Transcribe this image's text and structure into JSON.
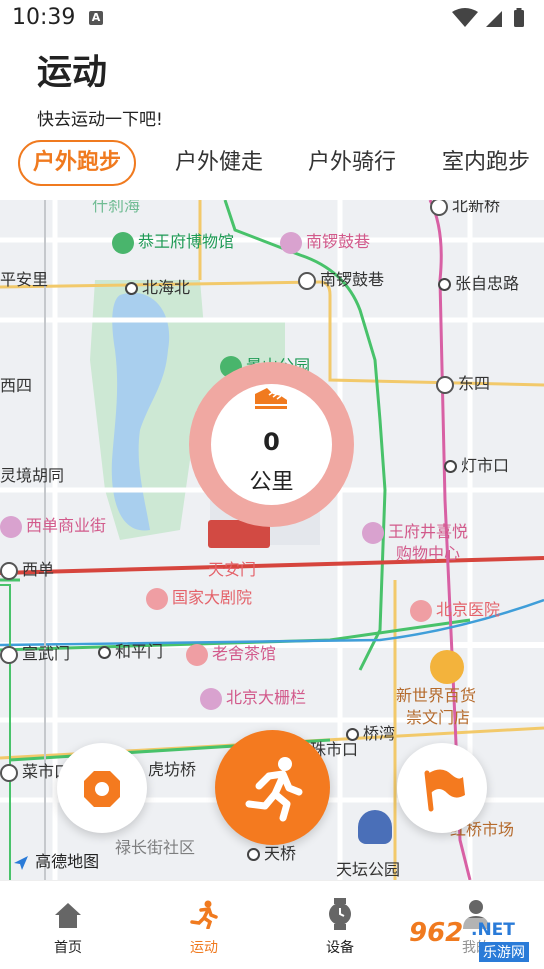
{
  "status_bar": {
    "time": "10:39",
    "notification_letter": "A"
  },
  "header": {
    "title": "运动",
    "subtitle": "快去运动一下吧!"
  },
  "tabs": [
    {
      "label": "户外跑步",
      "active": true
    },
    {
      "label": "户外健走",
      "active": false
    },
    {
      "label": "户外骑行",
      "active": false
    },
    {
      "label": "室内跑步",
      "active": false
    }
  ],
  "map": {
    "provider_label": "高德地图",
    "labels": {
      "shichahai": "什刹海",
      "beixinqiao": "北新桥",
      "gongwangfu": "恭王府博物馆",
      "nanluoguxiang_poi": "南锣鼓巷",
      "pinganli": "平安里",
      "beihaibei": "北海北",
      "nanluoguxiang_station": "南锣鼓巷",
      "zhangzizhonglu": "张自忠路",
      "jingshan": "景山公园",
      "xisi": "西四",
      "dongsi": "东四",
      "lingjinghutong": "灵境胡同",
      "dengshikou": "灯市口",
      "xidanmall": "西单商业街",
      "wangfujing": "王府井喜悦",
      "wangfujing2": "购物中心",
      "xidan": "西单",
      "tiananmen": "天安门",
      "nationaltheatre": "国家大剧院",
      "pumc": "北京医院",
      "xuanwumen": "宣武门",
      "hepingmen": "和平门",
      "laoshe": "老舍茶馆",
      "dashilan": "北京大栅栏",
      "xinshijie": "新世界百货",
      "chongwenmen": "崇文门店",
      "qiaowan": "桥湾",
      "caishikou": "菜市口",
      "hufangqiao": "虎坊桥",
      "zhushikou": "珠市口",
      "tianqiao": "天桥",
      "luchangjie": "禄长街社区",
      "tiantan": "天坛公园",
      "hongqiao": "红桥市场"
    }
  },
  "distance": {
    "value": "0",
    "unit": "公里"
  },
  "bottom_nav": [
    {
      "label": "首页",
      "icon": "home-icon",
      "active": false
    },
    {
      "label": "运动",
      "icon": "running-icon",
      "active": true
    },
    {
      "label": "设备",
      "icon": "watch-icon",
      "active": false
    },
    {
      "label": "我的",
      "icon": "profile-icon",
      "active": false
    }
  ],
  "watermark": {
    "number": "962",
    "suffix": ".NET",
    "site": "乐游网"
  },
  "colors": {
    "accent": "#f47a1f",
    "ring": "#f0a8a2",
    "map_bg": "#eef0f3"
  }
}
